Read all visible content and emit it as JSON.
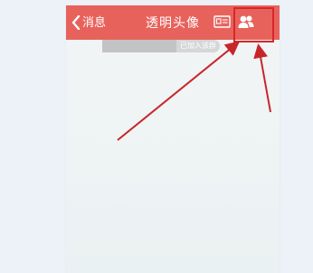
{
  "header": {
    "back_label": "消息",
    "title": "透明头像"
  },
  "notice": {
    "text": "已加入该群"
  },
  "icons": {
    "back": "chevron-left-icon",
    "card": "id-card-icon",
    "members": "group-members-icon"
  },
  "colors": {
    "title_bar": "#e8625c",
    "highlight": "#d8262a",
    "annotation_arrow": "#c8252a",
    "screen_bg": "#eef3f4",
    "page_bg": "#edf1f8"
  }
}
